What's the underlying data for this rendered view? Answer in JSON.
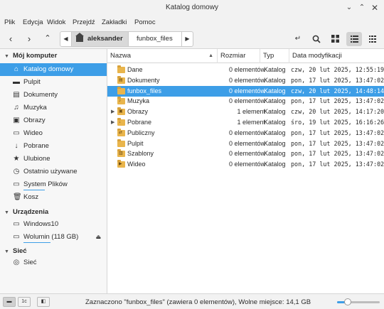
{
  "window": {
    "title": "Katalog domowy",
    "minimize_icon": "minimize-icon",
    "maximize_icon": "maximize-icon",
    "close_icon": "close-icon"
  },
  "menu": [
    "Plik",
    "Edycja",
    "Widok",
    "Przejdź",
    "Zakładki",
    "Pomoc"
  ],
  "toolbar": {
    "back_icon": "arrow-left-icon",
    "forward_icon": "arrow-right-icon",
    "up_icon": "arrow-up-icon",
    "path": [
      "aleksander",
      "funbox_files"
    ],
    "right_icons": [
      "open-terminal-icon",
      "search-icon",
      "icon-view-icon",
      "list-view-icon",
      "compact-view-icon"
    ],
    "active_view": "list-view-icon"
  },
  "sidebar": {
    "sections": [
      {
        "title": "Mój komputer",
        "items": [
          {
            "label": "Katalog domowy",
            "icon": "home-icon",
            "selected": true
          },
          {
            "label": "Pulpit",
            "icon": "desktop-icon"
          },
          {
            "label": "Dokumenty",
            "icon": "documents-icon"
          },
          {
            "label": "Muzyka",
            "icon": "music-icon"
          },
          {
            "label": "Obrazy",
            "icon": "pictures-icon"
          },
          {
            "label": "Wideo",
            "icon": "video-icon"
          },
          {
            "label": "Pobrane",
            "icon": "download-icon"
          },
          {
            "label": "Ulubione",
            "icon": "star-icon"
          },
          {
            "label": "Ostatnio używane",
            "icon": "recent-icon"
          },
          {
            "label": "System Plików",
            "icon": "drive-icon"
          },
          {
            "label": "Kosz",
            "icon": "trash-icon"
          }
        ]
      },
      {
        "title": "Urządzenia",
        "items": [
          {
            "label": "Windows10",
            "icon": "drive-icon"
          },
          {
            "label": "Wolumin (118 GB)",
            "icon": "drive-icon",
            "eject": true
          }
        ]
      },
      {
        "title": "Sieć",
        "items": [
          {
            "label": "Sieć",
            "icon": "network-icon"
          }
        ]
      }
    ]
  },
  "columns": {
    "name": "Nazwa",
    "size": "Rozmiar",
    "type": "Typ",
    "date": "Data modyfikacji"
  },
  "files": [
    {
      "name": "Dane",
      "size": "0 elementów",
      "type": "Katalog",
      "date": "czw, 20 lut 2025, 12:55:19",
      "emblem": ""
    },
    {
      "name": "Dokumenty",
      "size": "0 elementów",
      "type": "Katalog",
      "date": "pon, 17 lut 2025, 13:47:02",
      "emblem": "▤"
    },
    {
      "name": "funbox_files",
      "size": "0 elementów",
      "type": "Katalog",
      "date": "czw, 20 lut 2025, 14:48:14",
      "emblem": "",
      "selected": true
    },
    {
      "name": "Muzyka",
      "size": "0 elementów",
      "type": "Katalog",
      "date": "pon, 17 lut 2025, 13:47:02",
      "emblem": "♪"
    },
    {
      "name": "Obrazy",
      "size": "1 element",
      "type": "Katalog",
      "date": "czw, 20 lut 2025, 14:17:20",
      "emblem": "▣",
      "expandable": true
    },
    {
      "name": "Pobrane",
      "size": "1 element",
      "type": "Katalog",
      "date": "śro, 19 lut 2025, 16:16:26",
      "emblem": "↓",
      "expandable": true
    },
    {
      "name": "Publiczny",
      "size": "0 elementów",
      "type": "Katalog",
      "date": "pon, 17 lut 2025, 13:47:02",
      "emblem": "⇄"
    },
    {
      "name": "Pulpit",
      "size": "0 elementów",
      "type": "Katalog",
      "date": "pon, 17 lut 2025, 13:47:02",
      "emblem": ""
    },
    {
      "name": "Szablony",
      "size": "0 elementów",
      "type": "Katalog",
      "date": "pon, 17 lut 2025, 13:47:02",
      "emblem": "▥"
    },
    {
      "name": "Wideo",
      "size": "0 elementów",
      "type": "Katalog",
      "date": "pon, 17 lut 2025, 13:47:02",
      "emblem": "▶"
    }
  ],
  "statusbar": {
    "text": "Zaznaczono \"funbox_files\" (zawiera 0 elementów), Wolne miejsce: 14,1 GB",
    "buttons": [
      "places-icon",
      "tree-icon",
      "toggle-sidebar-icon"
    ],
    "button_labels": [
      "",
      "1c",
      ""
    ],
    "zoom_level": 0.25
  },
  "colors": {
    "accent": "#3d9ee7",
    "folder": "#e9b54c"
  }
}
